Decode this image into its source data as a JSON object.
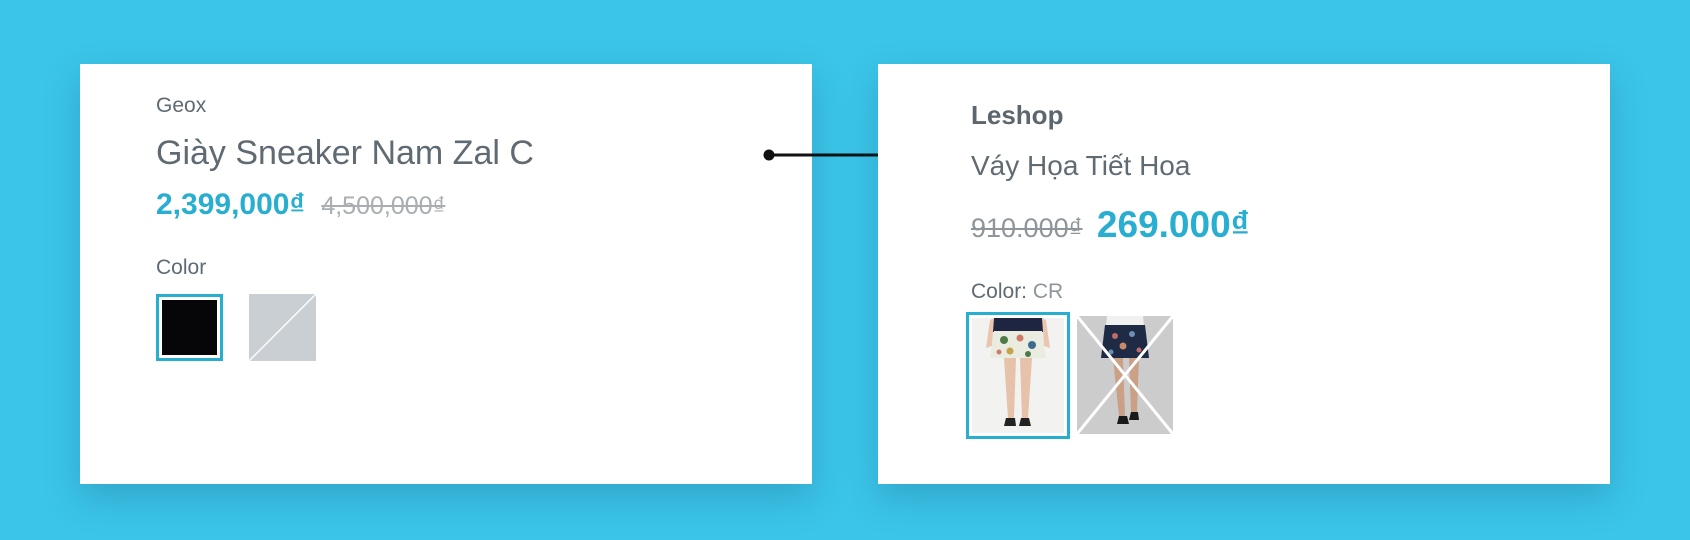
{
  "left_card": {
    "brand": "Geox",
    "title": "Giày Sneaker Nam Zal C",
    "sale_price": "2,399,000₫",
    "original_price": "4,500,000₫",
    "color_label": "Color",
    "swatches": [
      {
        "name": "black",
        "color": "#060608",
        "selected": true
      },
      {
        "name": "gray",
        "color": "#c9cfd3",
        "selected": false,
        "unavailable": true
      }
    ]
  },
  "right_card": {
    "brand": "Leshop",
    "title": "Váy Họa Tiết Hoa",
    "original_price": "910.000₫",
    "sale_price": "269.000₫",
    "color_label": "Color:",
    "color_value": "CR",
    "thumbnails": [
      {
        "name": "floral-skirt-white",
        "selected": true
      },
      {
        "name": "floral-skirt-navy",
        "selected": false,
        "unavailable": true
      }
    ]
  },
  "colors": {
    "background": "#3bc5e8",
    "accent": "#28aed0",
    "text": "#5f6a72",
    "muted": "#a8aeb2"
  }
}
